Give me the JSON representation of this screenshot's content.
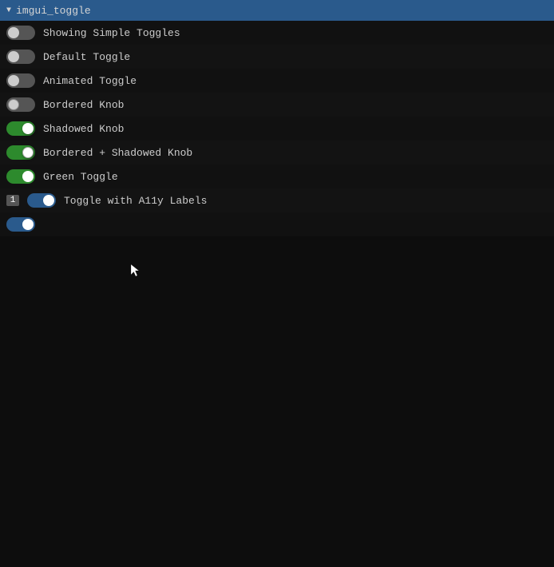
{
  "titleBar": {
    "arrow": "▼",
    "title": "imgui_toggle"
  },
  "header": {
    "label": "Showing Simple Toggles"
  },
  "rows": [
    {
      "id": "default",
      "label": "Default Toggle",
      "toggleClass": "toggle-default",
      "badge": null
    },
    {
      "id": "animated",
      "label": "Animated Toggle",
      "toggleClass": "toggle-animated",
      "badge": null
    },
    {
      "id": "bordered",
      "label": "Bordered Knob",
      "toggleClass": "toggle-bordered",
      "badge": null
    },
    {
      "id": "shadowed",
      "label": "Shadowed Knob",
      "toggleClass": "toggle-shadowed",
      "badge": null
    },
    {
      "id": "bordered-shadowed",
      "label": "Bordered + Shadowed Knob",
      "toggleClass": "toggle-bordered-shadowed",
      "badge": null
    },
    {
      "id": "green",
      "label": "Green Toggle",
      "toggleClass": "toggle-green",
      "badge": null
    },
    {
      "id": "a11y",
      "label": "Toggle with A11y Labels",
      "toggleClass": "toggle-a11y",
      "badge": "1"
    }
  ],
  "bottomToggle": {
    "toggleClass": "toggle-bottom"
  }
}
